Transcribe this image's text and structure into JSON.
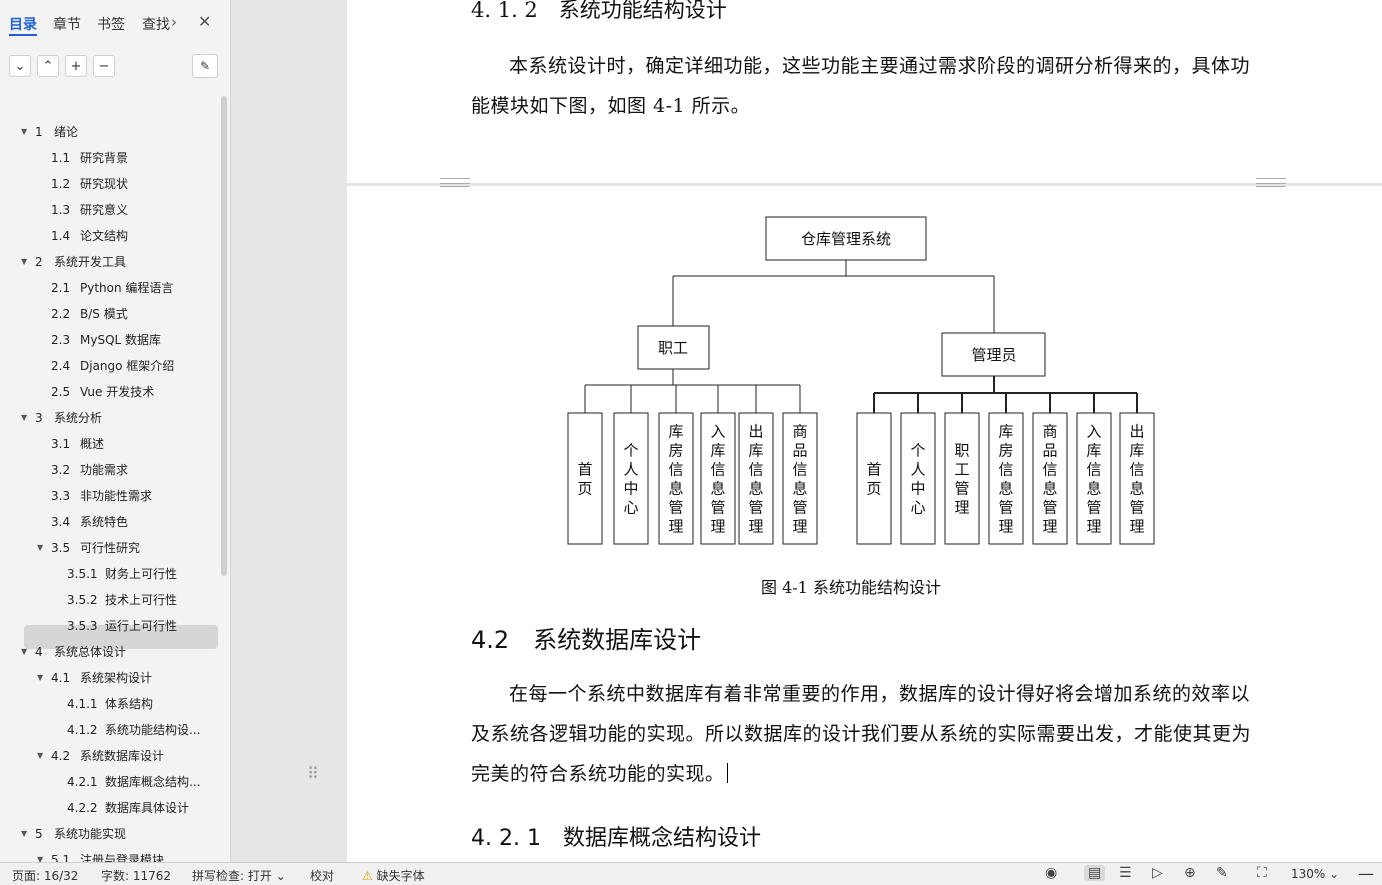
{
  "sidebar": {
    "tabs": [
      "目录",
      "章节",
      "书签",
      "查找"
    ],
    "toc": [
      {
        "num": "1",
        "label": "绪论",
        "level": 1,
        "expand": true
      },
      {
        "num": "1.1",
        "label": "研究背景",
        "level": 2
      },
      {
        "num": "1.2",
        "label": "研究现状",
        "level": 2
      },
      {
        "num": "1.3",
        "label": "研究意义",
        "level": 2
      },
      {
        "num": "1.4",
        "label": "论文结构",
        "level": 2
      },
      {
        "num": "2",
        "label": "系统开发工具",
        "level": 1,
        "expand": true
      },
      {
        "num": "2.1",
        "label": "Python 编程语言",
        "level": 2
      },
      {
        "num": "2.2",
        "label": "B/S 模式",
        "level": 2
      },
      {
        "num": "2.3",
        "label": "MySQL 数据库",
        "level": 2
      },
      {
        "num": "2.4",
        "label": "Django 框架介绍",
        "level": 2
      },
      {
        "num": "2.5",
        "label": "Vue 开发技术",
        "level": 2
      },
      {
        "num": "3",
        "label": "系统分析",
        "level": 1,
        "expand": true
      },
      {
        "num": "3.1",
        "label": "概述",
        "level": 2
      },
      {
        "num": "3.2",
        "label": "功能需求",
        "level": 2
      },
      {
        "num": "3.3",
        "label": "非功能性需求",
        "level": 2
      },
      {
        "num": "3.4",
        "label": "系统特色",
        "level": 2
      },
      {
        "num": "3.5",
        "label": "可行性研究",
        "level": 2,
        "expand": true
      },
      {
        "num": "3.5.1",
        "label": "财务上可行性",
        "level": 3
      },
      {
        "num": "3.5.2",
        "label": "技术上可行性",
        "level": 3
      },
      {
        "num": "3.5.3",
        "label": "运行上可行性",
        "level": 3
      },
      {
        "num": "4",
        "label": "系统总体设计",
        "level": 1,
        "expand": true
      },
      {
        "num": "4.1",
        "label": "系统架构设计",
        "level": 2,
        "expand": true
      },
      {
        "num": "4.1.1",
        "label": "体系结构",
        "level": 3
      },
      {
        "num": "4.1.2",
        "label": "系统功能结构设...",
        "level": 3
      },
      {
        "num": "4.2",
        "label": "系统数据库设计",
        "level": 2,
        "expand": true,
        "selected": true
      },
      {
        "num": "4.2.1",
        "label": "数据库概念结构...",
        "level": 3
      },
      {
        "num": "4.2.2",
        "label": "数据库具体设计",
        "level": 3
      },
      {
        "num": "5",
        "label": "系统功能实现",
        "level": 1,
        "expand": true
      },
      {
        "num": "5.1",
        "label": "注册与登录模块",
        "level": 2,
        "expand": true
      }
    ]
  },
  "doc": {
    "heading_412": "4. 1. 2　系统功能结构设计",
    "para1": "本系统设计时，确定详细功能，这些功能主要通过需求阶段的调研分析得来的，具体功能模块如下图，如图 4-1 所示。",
    "diagram": {
      "root": "仓库管理系统",
      "left": {
        "label": "职工",
        "children": [
          "首页",
          "个人中心",
          "库房信息管理",
          "入库信息管理",
          "出库信息管理",
          "商品信息管理"
        ]
      },
      "right": {
        "label": "管理员",
        "children": [
          "首页",
          "个人中心",
          "职工管理",
          "库房信息管理",
          "商品信息管理",
          "入库信息管理",
          "出库信息管理"
        ]
      }
    },
    "fig_caption": "图 4-1  系统功能结构设计",
    "heading_42": "4.2　系统数据库设计",
    "para2": "在每一个系统中数据库有着非常重要的作用，数据库的设计得好将会增加系统的效率以及系统各逻辑功能的实现。所以数据库的设计我们要从系统的实际需要出发，才能使其更为完美的符合系统功能的实现。",
    "heading_421": "4. 2. 1　数据库概念结构设计"
  },
  "status": {
    "page": "页面: 16/32",
    "words": "字数: 11762",
    "spell": "拼写检查: 打开",
    "proof": "校对",
    "missing_font": "缺失字体",
    "zoom": "130%"
  }
}
